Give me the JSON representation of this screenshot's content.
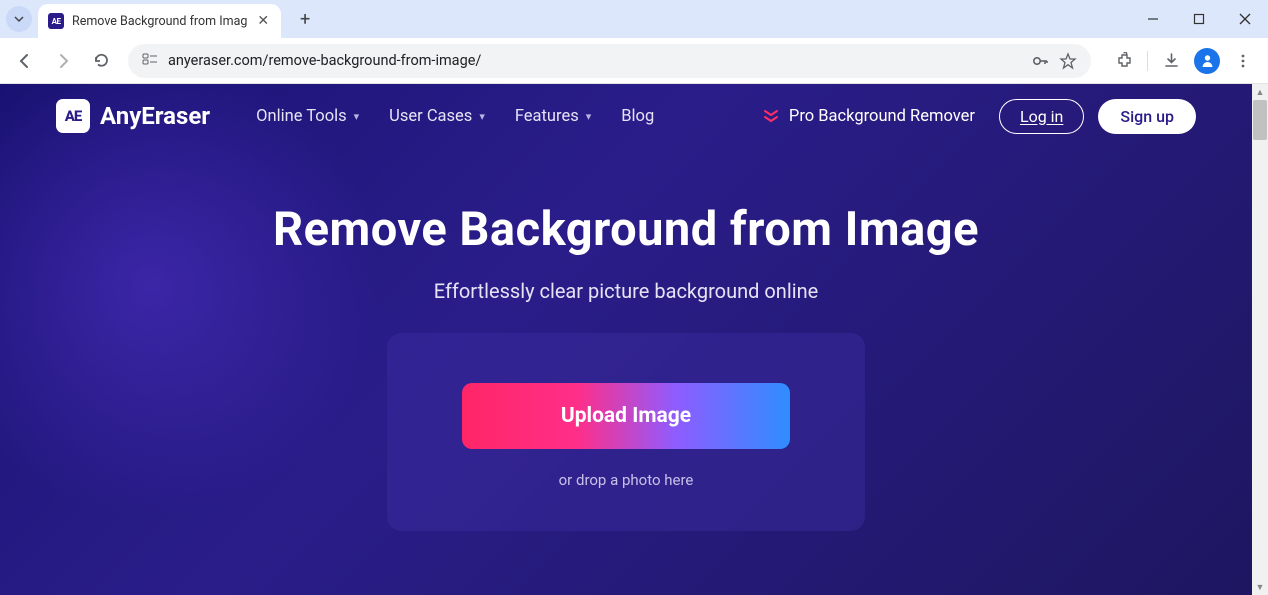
{
  "browser": {
    "tab_title": "Remove Background from Imag",
    "url": "anyeraser.com/remove-background-from-image/"
  },
  "header": {
    "logo_badge": "AE",
    "logo_text": "AnyEraser",
    "nav": {
      "online_tools": "Online Tools",
      "user_cases": "User Cases",
      "features": "Features",
      "blog": "Blog"
    },
    "pro_label": "Pro Background Remover",
    "login": "Log in",
    "signup": "Sign up"
  },
  "hero": {
    "title": "Remove Background from Image",
    "subtitle": "Effortlessly clear picture background online",
    "upload_button": "Upload Image",
    "drop_text": "or drop a photo here"
  }
}
